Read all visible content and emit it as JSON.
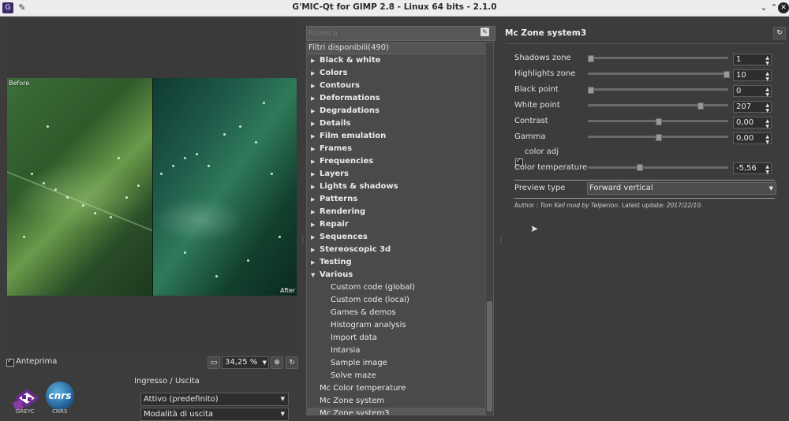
{
  "window": {
    "title": "G'MIC-Qt for GIMP 2.8 - Linux 64 bits - 2.1.0"
  },
  "preview": {
    "before_label": "Before",
    "after_label": "After",
    "checkbox_label": "Anteprima",
    "checkbox_checked": true,
    "zoom_value": "34,25 %",
    "logo_gmic_text": "GREYC",
    "logo_cnrs_text": "CNRS",
    "cnrs_mark": "cnrs"
  },
  "io": {
    "title": "Ingresso / Uscita",
    "input_mode": "Attivo (predefinito)",
    "output_mode": "Modalità di uscita"
  },
  "search": {
    "placeholder": "Ricerca"
  },
  "filters": {
    "header": "Filtri disponibili(490)",
    "items": [
      {
        "label": "Black & white",
        "kind": "cat"
      },
      {
        "label": "Colors",
        "kind": "cat"
      },
      {
        "label": "Contours",
        "kind": "cat"
      },
      {
        "label": "Deformations",
        "kind": "cat"
      },
      {
        "label": "Degradations",
        "kind": "cat"
      },
      {
        "label": "Details",
        "kind": "cat"
      },
      {
        "label": "Film emulation",
        "kind": "cat"
      },
      {
        "label": "Frames",
        "kind": "cat"
      },
      {
        "label": "Frequencies",
        "kind": "cat"
      },
      {
        "label": "Layers",
        "kind": "cat"
      },
      {
        "label": "Lights & shadows",
        "kind": "cat"
      },
      {
        "label": "Patterns",
        "kind": "cat"
      },
      {
        "label": "Rendering",
        "kind": "cat"
      },
      {
        "label": "Repair",
        "kind": "cat"
      },
      {
        "label": "Sequences",
        "kind": "cat"
      },
      {
        "label": "Stereoscopic 3d",
        "kind": "cat"
      },
      {
        "label": "Testing",
        "kind": "cat"
      },
      {
        "label": "Various",
        "kind": "cat-open"
      },
      {
        "label": "Custom code (global)",
        "kind": "sub"
      },
      {
        "label": "Custom code (local)",
        "kind": "sub"
      },
      {
        "label": "Games & demos",
        "kind": "sub"
      },
      {
        "label": "Histogram analysis",
        "kind": "sub"
      },
      {
        "label": "Import data",
        "kind": "sub"
      },
      {
        "label": "Intarsia",
        "kind": "sub"
      },
      {
        "label": "Sample image",
        "kind": "sub"
      },
      {
        "label": "Solve maze",
        "kind": "sub"
      },
      {
        "label": "Mc Color temperature",
        "kind": "leaf"
      },
      {
        "label": "Mc Zone system",
        "kind": "leaf"
      },
      {
        "label": "Mc Zone system3",
        "kind": "leaf-selected"
      }
    ]
  },
  "settings": {
    "filter_title": "Mc Zone system3",
    "params": [
      {
        "label": "Shadows zone",
        "value": "1",
        "fraction": 0.0
      },
      {
        "label": "Highlights zone",
        "value": "10",
        "fraction": 1.0
      },
      {
        "label": "Black point",
        "value": "0",
        "fraction": 0.0
      },
      {
        "label": "White point",
        "value": "207",
        "fraction": 0.81
      },
      {
        "label": "Contrast",
        "value": "0,00",
        "fraction": 0.5
      },
      {
        "label": "Gamma",
        "value": "0,00",
        "fraction": 0.5
      }
    ],
    "color_adj_label": "color adj",
    "color_adj_checked": true,
    "color_temperature": {
      "label": "Color temperature",
      "value": "-5,56",
      "fraction": 0.36
    },
    "preview_type_label": "Preview type",
    "preview_type_value": "Forward vertical",
    "author_prefix": "Author : ",
    "author_name": "Tom Keil mod by Telperion",
    "update_text": ". Latest update: ",
    "update_date": "2017/22/10."
  },
  "icons": {
    "app": "gmic-icon",
    "pin": "pin-icon",
    "minimize": "chevron-down-icon",
    "maximize": "chevron-up-icon",
    "close": "close-icon",
    "zoom_out": "zoom-out-icon",
    "zoom_in": "zoom-in-icon",
    "refresh": "refresh-icon",
    "search_clear": "clear-search-icon",
    "reset": "reset-icon"
  },
  "colors": {
    "background": "#3c3c3c",
    "panel": "#4a4a4a",
    "titlebar": "#ededed"
  }
}
